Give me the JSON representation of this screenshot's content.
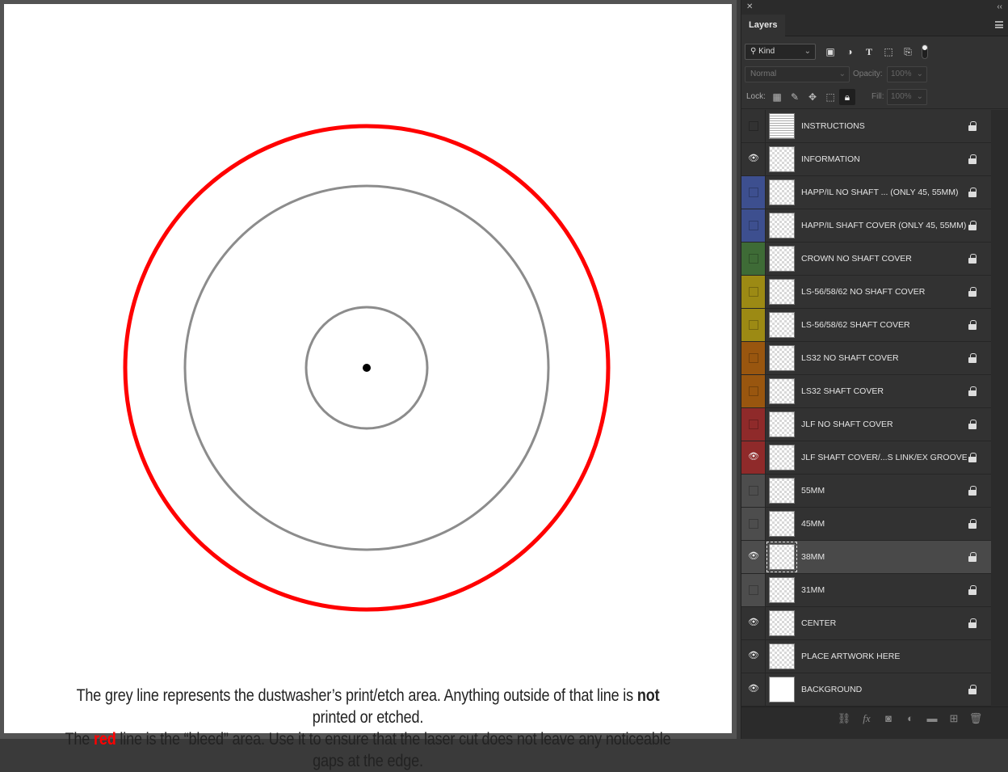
{
  "canvas": {
    "caption": {
      "line1_before": "The grey line represents the dustwasher’s print/etch area. Anything outside of that line is ",
      "line1_bold": "not",
      "line1_after": " printed or etched.",
      "line2_before": "The ",
      "line2_red": "red",
      "line2_after": " line is the “bleed” area.  Use it to ensure that the laser cut does not leave any noticeable gaps at the edge."
    },
    "colors": {
      "bleed_ring": "#ff0000",
      "print_rings": "#8c8c8c",
      "center_dot": "#000000"
    }
  },
  "panel": {
    "title": "Layers",
    "filter": {
      "kind_label": "Kind",
      "search_icon": "search-icon",
      "icons": [
        "image-filter-icon",
        "adjustment-filter-icon",
        "type-filter-icon",
        "shape-filter-icon",
        "smart-object-filter-icon"
      ]
    },
    "blend_mode": "Normal",
    "opacity_label": "Opacity:",
    "opacity_value": "100%",
    "lock_label": "Lock:",
    "fill_label": "Fill:",
    "fill_value": "100%"
  },
  "layers": [
    {
      "name": "INSTRUCTIONS",
      "visible": false,
      "color": "",
      "thumb": "doc",
      "locked": true
    },
    {
      "name": "INFORMATION",
      "visible": true,
      "color": "",
      "thumb": "transparent",
      "locked": true
    },
    {
      "name": "HAPP/IL NO SHAFT ... (ONLY 45, 55MM)",
      "visible": false,
      "color": "#3d4f8f",
      "thumb": "transparent",
      "locked": true
    },
    {
      "name": "HAPP/IL SHAFT COVER (ONLY 45, 55MM)",
      "visible": false,
      "color": "#3d4f8f",
      "thumb": "transparent",
      "locked": true
    },
    {
      "name": "CROWN NO SHAFT COVER",
      "visible": false,
      "color": "#3e6b36",
      "thumb": "transparent",
      "locked": true
    },
    {
      "name": "LS-56/58/62 NO SHAFT COVER",
      "visible": false,
      "color": "#9c8a14",
      "thumb": "transparent",
      "locked": true
    },
    {
      "name": "LS-56/58/62 SHAFT COVER",
      "visible": false,
      "color": "#9c8a14",
      "thumb": "transparent",
      "locked": true
    },
    {
      "name": "LS32 NO SHAFT COVER",
      "visible": false,
      "color": "#99560f",
      "thumb": "transparent",
      "locked": true
    },
    {
      "name": "LS32 SHAFT COVER",
      "visible": false,
      "color": "#99560f",
      "thumb": "transparent",
      "locked": true
    },
    {
      "name": "JLF NO SHAFT COVER",
      "visible": false,
      "color": "#8f2a2a",
      "thumb": "transparent",
      "locked": true
    },
    {
      "name": "JLF SHAFT COVER/...S LINK/EX GROOVE",
      "visible": true,
      "color": "#8f2a2a",
      "thumb": "transparent",
      "locked": true
    },
    {
      "name": "55MM",
      "visible": false,
      "color": "#4d4d4d",
      "thumb": "transparent",
      "locked": true
    },
    {
      "name": "45MM",
      "visible": false,
      "color": "#4d4d4d",
      "thumb": "transparent",
      "locked": true
    },
    {
      "name": "38MM",
      "visible": true,
      "color": "#4d4d4d",
      "thumb": "framed",
      "locked": true,
      "selected": true
    },
    {
      "name": "31MM",
      "visible": false,
      "color": "#4d4d4d",
      "thumb": "transparent",
      "locked": true
    },
    {
      "name": "CENTER",
      "visible": true,
      "color": "",
      "thumb": "transparent",
      "locked": true
    },
    {
      "name": "PLACE ARTWORK HERE",
      "visible": true,
      "color": "",
      "thumb": "transparent",
      "locked": false
    },
    {
      "name": "BACKGROUND",
      "visible": true,
      "color": "",
      "thumb": "solid",
      "locked": true
    }
  ],
  "bottom_bar": {
    "icons": [
      "link-layers-icon",
      "fx-icon",
      "add-mask-icon",
      "adjustment-layer-icon",
      "new-group-icon",
      "new-layer-icon",
      "trash-icon"
    ],
    "fx_label": "fx"
  }
}
